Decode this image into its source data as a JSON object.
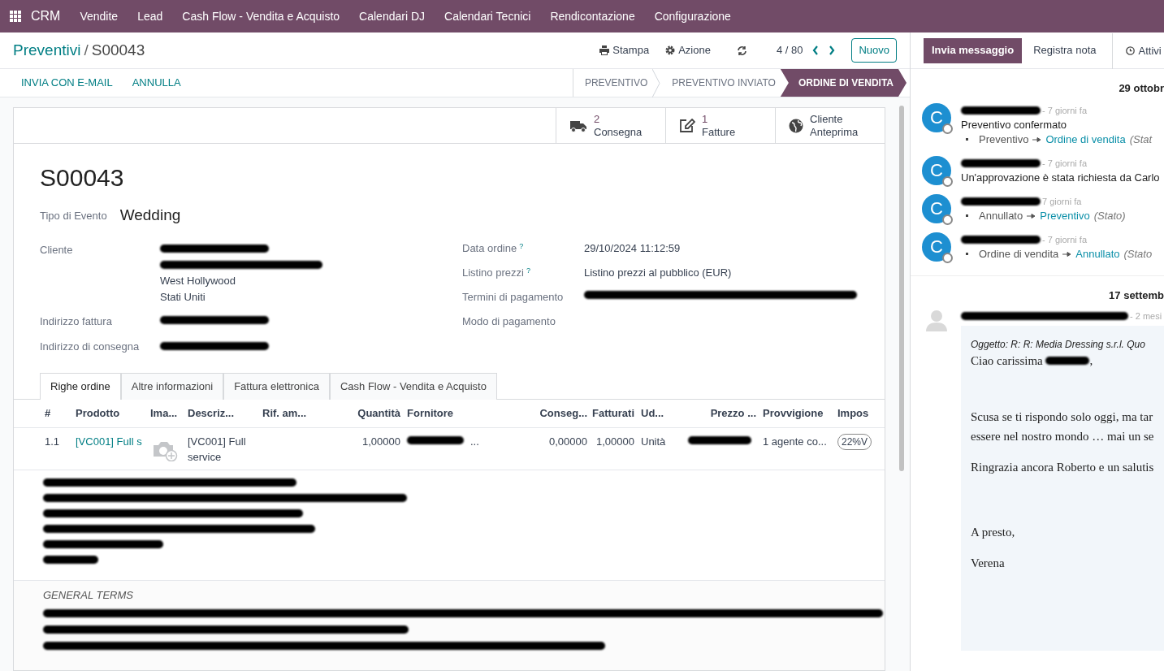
{
  "navbar": {
    "app": "CRM",
    "menu": [
      "Vendite",
      "Lead",
      "Cash Flow - Vendita e Acquisto",
      "Calendari DJ",
      "Calendari Tecnici",
      "Rendicontazione",
      "Configurazione"
    ]
  },
  "breadcrumb": {
    "parent": "Preventivi",
    "separator": "/",
    "current": "S00043"
  },
  "control_panel": {
    "print": "Stampa",
    "action": "Azione",
    "pager": "4 / 80",
    "new_button": "Nuovo"
  },
  "header_buttons": [
    "INVIA CON E-MAIL",
    "ANNULLA"
  ],
  "stages": [
    {
      "label": "PREVENTIVO",
      "selected": false
    },
    {
      "label": "PREVENTIVO INVIATO",
      "selected": false
    },
    {
      "label": "ORDINE DI VENDITA",
      "selected": true
    }
  ],
  "smart_buttons": [
    {
      "kind": "truck",
      "count": "2",
      "label": "Consegna"
    },
    {
      "kind": "edit",
      "count": "1",
      "label": "Fatture"
    },
    {
      "kind": "globe",
      "line1": "Cliente",
      "line2": "Anteprima"
    }
  ],
  "title": "S00043",
  "event_type": {
    "label": "Tipo di Evento",
    "value": "Wedding"
  },
  "left_fields": [
    {
      "label": "Cliente",
      "lines": [
        {
          "kind": "redacted"
        },
        {
          "kind": "redacted"
        },
        {
          "kind": "text",
          "text": "West Hollywood"
        },
        {
          "kind": "text",
          "text": "Stati Uniti"
        }
      ]
    },
    {
      "label": "Indirizzo fattura",
      "lines": [
        {
          "kind": "redacted"
        }
      ]
    },
    {
      "label": "Indirizzo di consegna",
      "lines": [
        {
          "kind": "redacted"
        }
      ]
    }
  ],
  "right_fields": [
    {
      "label": "Data ordine",
      "help": "?",
      "value": {
        "kind": "text",
        "text": "29/10/2024 11:12:59"
      }
    },
    {
      "label": "Listino prezzi",
      "help": "?",
      "value": {
        "kind": "text",
        "text": "Listino prezzi al pubblico (EUR)"
      }
    },
    {
      "label": "Termini di pagamento",
      "value": {
        "kind": "redacted"
      }
    },
    {
      "label": "Modo di pagamento"
    }
  ],
  "tabs": [
    {
      "label": "Righe ordine",
      "selected": true
    },
    {
      "label": "Altre informazioni",
      "selected": false
    },
    {
      "label": "Fattura elettronica",
      "selected": false
    },
    {
      "label": "Cash Flow - Vendita e Acquisto",
      "selected": false
    }
  ],
  "table": {
    "columns": [
      "#",
      "Prodotto",
      "Ima...",
      "Descriz...",
      "Rif. am...",
      "Quantità",
      "Fornitore",
      "Conseg...",
      "Fatturati",
      "Ud...",
      "Prezzo ...",
      "Provvigione",
      "Impos"
    ],
    "rows": [
      {
        "cells": [
          {
            "kind": "text",
            "text": "1.1"
          },
          {
            "kind": "link",
            "text": "[VC001] Full s"
          },
          {
            "kind": "image"
          },
          {
            "kind": "text",
            "text": "[VC001] Full service"
          },
          {
            "kind": "empty"
          },
          {
            "kind": "number",
            "text": "1,00000"
          },
          {
            "kind": "redacted",
            "suffix": "..."
          },
          {
            "kind": "number",
            "text": "0,00000"
          },
          {
            "kind": "number",
            "text": "1,00000"
          },
          {
            "kind": "text",
            "text": "Unità"
          },
          {
            "kind": "redacted"
          },
          {
            "kind": "text",
            "text": "1 agente co..."
          },
          {
            "kind": "badge",
            "text": "22%V"
          }
        ]
      }
    ]
  },
  "description_lines": [
    {
      "kind": "redacted"
    },
    {
      "kind": "redacted"
    },
    {
      "kind": "redacted"
    },
    {
      "kind": "redacted"
    },
    {
      "kind": "redacted"
    },
    {
      "kind": "redacted"
    }
  ],
  "terms": {
    "heading": "GENERAL TERMS",
    "lines": [
      {
        "kind": "redacted"
      },
      {
        "kind": "redacted"
      },
      {
        "kind": "redacted"
      }
    ]
  },
  "chatter": {
    "buttons": [
      {
        "label": "Invia messaggio",
        "selected": true
      },
      {
        "label": "Registra nota",
        "selected": false
      }
    ],
    "activities": "Attivi",
    "groups": [
      {
        "date": "29 ottobr",
        "messages": [
          {
            "avatar": "C",
            "author": {
              "kind": "redacted"
            },
            "time": "- 7 giorni fa",
            "body": "Preventivo confermato",
            "tracking": [
              {
                "from": "Preventivo",
                "to": "Ordine di vendita",
                "field": "(Stat"
              }
            ]
          },
          {
            "avatar": "C",
            "author": {
              "kind": "redacted"
            },
            "time": "- 7 giorni fa",
            "body": "Un'approvazione è stata richiesta da Carlo"
          },
          {
            "avatar": "C",
            "author": {
              "kind": "redacted"
            },
            "time": "7 giorni fa",
            "tracking": [
              {
                "from": "Annullato",
                "to": "Preventivo",
                "field": "(Stato)"
              }
            ]
          },
          {
            "avatar": "C",
            "author": {
              "kind": "redacted"
            },
            "time": "- 7 giorni fa",
            "tracking": [
              {
                "from": "Ordine di vendita",
                "to": "Annullato",
                "field": "(Stato"
              }
            ]
          }
        ]
      },
      {
        "date": "17 settemb",
        "email": {
          "author": {
            "kind": "redacted"
          },
          "time": "- 2 mesi",
          "subject": "Oggetto: R: R: Media Dressing s.r.l. Quo",
          "paragraphs": [
            {
              "parts": [
                {
                  "kind": "text",
                  "text": "Ciao carissima "
                },
                {
                  "kind": "redacted"
                },
                {
                  "kind": "text",
                  "text": ","
                }
              ]
            },
            {
              "lines": [
                "Scusa se ti rispondo solo oggi, ma tar",
                "essere nel nostro mondo … mai un se"
              ]
            },
            {
              "lines": [
                "Ringrazia ancora Roberto e un salutis"
              ]
            },
            {
              "lines": [
                "A presto,"
              ]
            },
            {
              "lines": [
                "Verena"
              ]
            }
          ]
        }
      }
    ]
  }
}
